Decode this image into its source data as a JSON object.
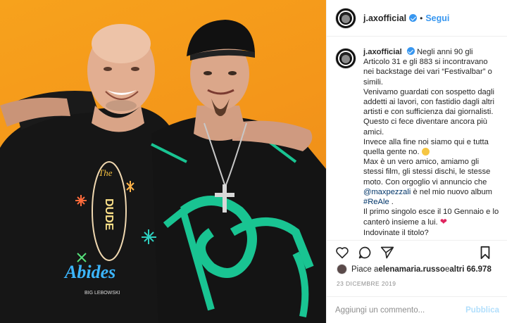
{
  "post": {
    "username": "j.axofficial",
    "follow_label": "Segui",
    "separator": "•"
  },
  "caption": {
    "username": "j.axofficial",
    "lines": [
      "Negli anni 90 gli Articolo 31 e gli 883 si incontravano nei backstage dei vari “Festivalbar” o simili.",
      "Venivamo guardati con sospetto dagli addetti ai lavori, con fastidio dagli altri artisti e con sufficienza dai giornalisti. Questo ci fece diventare ancora più amici.",
      "Invece alla fine noi siamo qui e tutta quella gente no.",
      "Max è un vero amico, amiamo gli stessi film, gli stessi dischi, le stesse moto. Con orgoglio vi annuncio che",
      "è nel mio nuovo album",
      "Il primo singolo esce il 10 Gennaio e lo canterò insieme a lui.",
      "Indovinate il titolo?"
    ],
    "mention": "@maxpezzali",
    "hashtag": "#ReAle",
    "hashtag_suffix": " ."
  },
  "likes": {
    "prefix": "Piace a ",
    "user": "elenamaria.russo",
    "middle": " e ",
    "others": "altri 66.978"
  },
  "date": "23 DICEMBRE 2019",
  "comment": {
    "placeholder": "Aggiungi un commento...",
    "publish_label": "Pubblica"
  },
  "photo": {
    "shirt_text_top": "The",
    "shirt_text_dude": "DUDE",
    "shirt_text_abides": "Abides",
    "shirt_text_bottom": "BIG LEBOWSKI"
  },
  "colors": {
    "accent": "#3897f0",
    "background_orange": "#f4961a",
    "publish_disabled": "#b2dffc",
    "heart": "#e0245e"
  },
  "icons": [
    "heart-icon",
    "comment-icon",
    "share-icon",
    "bookmark-icon",
    "verified-badge-icon"
  ]
}
